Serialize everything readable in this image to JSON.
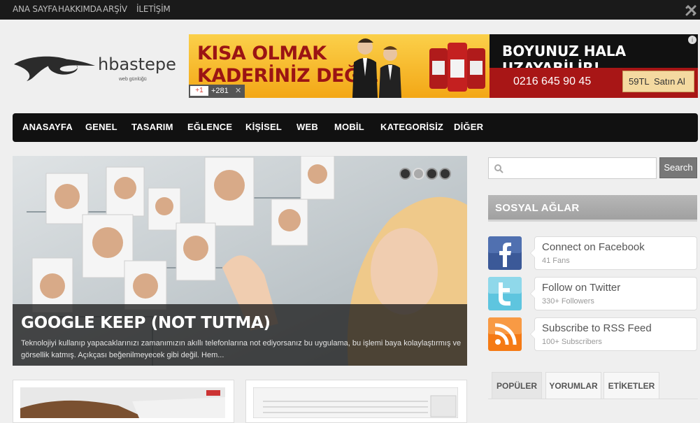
{
  "topnav": [
    "ANA SAYFA",
    "HAKKIMDA",
    "ARŞİV",
    "İLETİŞİM"
  ],
  "logo": {
    "text": "hbastepe",
    "tagline": "web günlüğü"
  },
  "ad": {
    "headline_1": "KISA OLMAK",
    "headline_2": "KADERİNİZ DEĞİL!",
    "right_title": "BOYUNUZ HALA UZAYABİLİR!",
    "phone": "0216 645 90 45",
    "price": "59TL",
    "buy_label": "Satın Al",
    "gplus_label": "+1",
    "gplus_count": "+281",
    "close": "✕",
    "info": "i"
  },
  "mainnav": [
    "ANASAYFA",
    "GENEL",
    "TASARIM",
    "EĞLENCE",
    "KİŞİSEL",
    "WEB",
    "MOBİL",
    "KATEGORİSİZ",
    "DİĞER"
  ],
  "slider": {
    "title": "GOOGLE KEEP (NOT TUTMA)",
    "excerpt": "Teknolojiyi kullanıp yapacaklarınızı zamanımızın akıllı telefonlarına not ediyorsanız bu uygulama, bu işlemi baya kolaylaştırmış ve görsellik katmış. Açıkçası beğenilmeyecek gibi değil. Hem...",
    "active_slide": 2,
    "slide_count": 4
  },
  "search": {
    "placeholder": "",
    "button_label": "Search"
  },
  "social_widget": {
    "title": "SOSYAL AĞLAR",
    "items": [
      {
        "title": "Connect on Facebook",
        "sub": "41 Fans",
        "icon": "facebook-icon",
        "color": "#3b5998"
      },
      {
        "title": "Follow on Twitter",
        "sub": "330+ Followers",
        "icon": "twitter-icon",
        "color": "#5ec5df"
      },
      {
        "title": "Subscribe to RSS Feed",
        "sub": "100+ Subscribers",
        "icon": "rss-icon",
        "color": "#f57a14"
      }
    ]
  },
  "tabs": [
    "POPÜLER",
    "YORUMLAR",
    "ETİKETLER"
  ],
  "colors": {
    "nav_bg": "#111111",
    "topbar_bg": "#1a1a1a",
    "ad_red": "#9b1414"
  }
}
